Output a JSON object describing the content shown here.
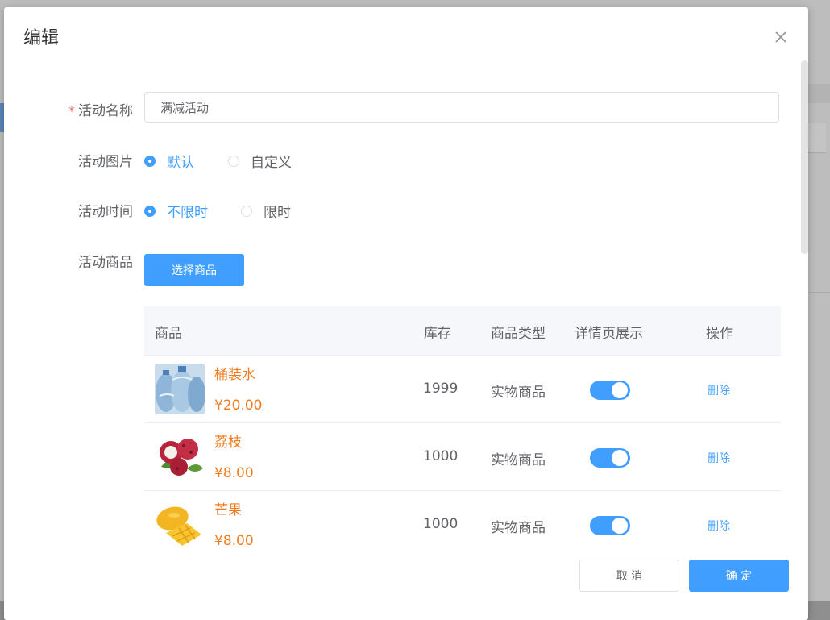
{
  "dialog": {
    "title": "编辑"
  },
  "form": {
    "name": {
      "label": "活动名称",
      "required_mark": "*",
      "value": "满减活动"
    },
    "image": {
      "label": "活动图片",
      "options": [
        "默认",
        "自定义"
      ],
      "selected": "默认"
    },
    "time": {
      "label": "活动时间",
      "options": [
        "不限时",
        "限时"
      ],
      "selected": "不限时"
    },
    "goods": {
      "label": "活动商品",
      "select_button": "选择商品"
    }
  },
  "table": {
    "headers": [
      "商品",
      "库存",
      "商品类型",
      "详情页展示",
      "操作"
    ],
    "rows": [
      {
        "name": "桶装水",
        "price": "¥20.00",
        "stock": "1999",
        "type": "实物商品",
        "show_on_detail": true,
        "action": "删除",
        "image": "water-bottle-image"
      },
      {
        "name": "荔枝",
        "price": "¥8.00",
        "stock": "1000",
        "type": "实物商品",
        "show_on_detail": true,
        "action": "删除",
        "image": "lychee-image"
      },
      {
        "name": "芒果",
        "price": "¥8.00",
        "stock": "1000",
        "type": "实物商品",
        "show_on_detail": true,
        "action": "删除",
        "image": "mango-image"
      }
    ]
  },
  "footer": {
    "cancel": "取 消",
    "confirm": "确 定"
  },
  "colors": {
    "primary": "#409eff",
    "price": "#f37b1d",
    "required": "#f56c6c"
  }
}
